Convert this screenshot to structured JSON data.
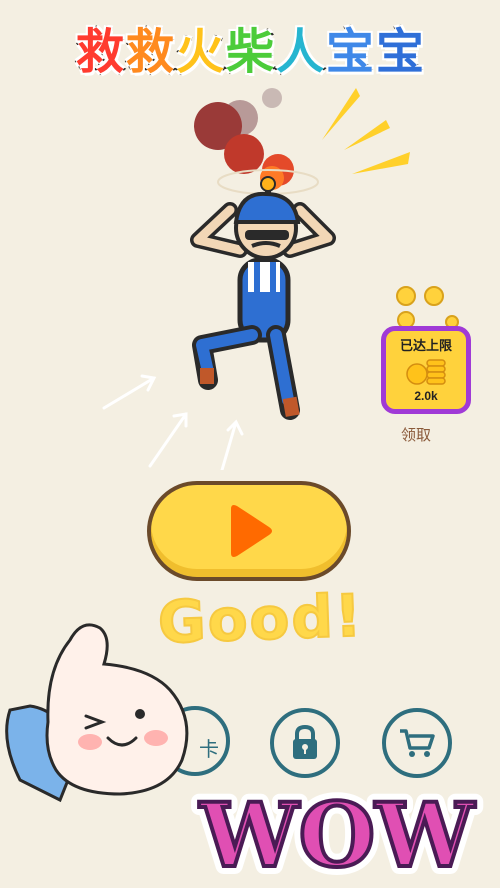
{
  "title_chars": [
    "救",
    "救",
    "火",
    "柴",
    "人",
    "宝",
    "宝"
  ],
  "title_colors": [
    "#ff3b2f",
    "#ff8a1f",
    "#ffc21a",
    "#4ccc3a",
    "#26b5d0",
    "#3f88e8",
    "#2f6fd8"
  ],
  "reward": {
    "limit_label": "已达上限",
    "amount": "2.0k",
    "claim_label": "领取"
  },
  "stickers": {
    "good_text": "Good!",
    "wow_text": "WOW"
  },
  "bottom_buttons": {
    "partial_label": "卡",
    "icons": [
      "card-icon",
      "lock-icon",
      "cart-icon"
    ]
  },
  "colors": {
    "background": "#f4efe2",
    "play_button": "#ffd84a",
    "play_icon": "#ff6a00",
    "reward_border": "#a03ad6",
    "icon_ring": "#2e6e7e"
  }
}
